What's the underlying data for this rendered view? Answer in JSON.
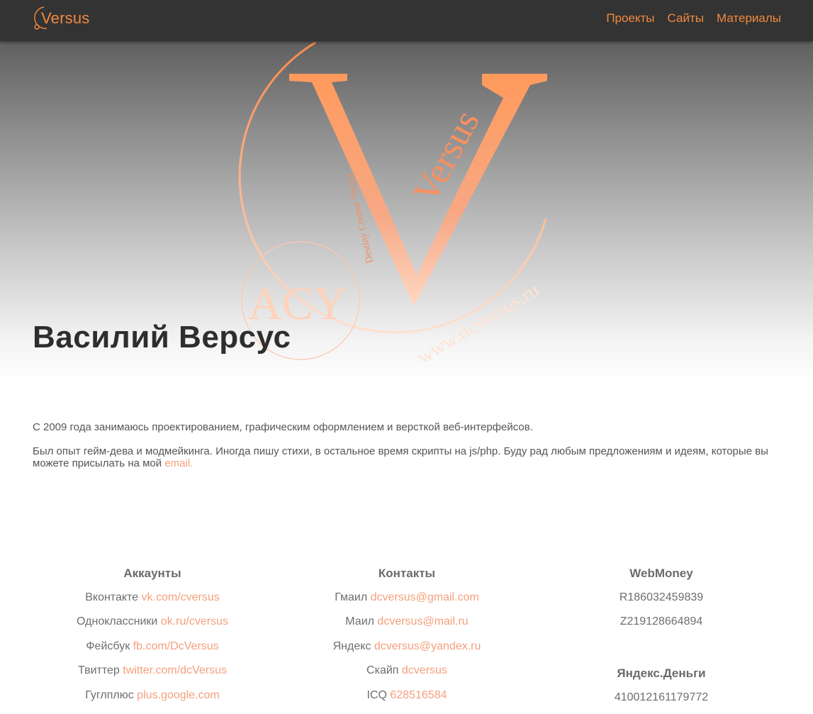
{
  "navbar": {
    "brand": "Versus",
    "links": [
      "Проекты",
      "Сайты",
      "Материалы"
    ]
  },
  "hero": {
    "name": "Василий Версус",
    "logo_texts": [
      "Versus",
      "Destiny Creator Versus",
      "ACY",
      "www.dcversus.ru"
    ]
  },
  "about": {
    "line1": "С 2009 года занимаюсь проектированием, графическим оформлением и версткой веб-интерфейсов.",
    "line2": "Был опыт гейм-дева и модмейкинга. Иногда пишу стихи, в остальное время скрипты на js/php. Буду рад любым предложениям и идеям, которые вы можете присылать на мой ",
    "email_link": "email."
  },
  "accounts": {
    "title": "Аккаунты",
    "items": [
      {
        "label": "Вконтакте",
        "link": "vk.com/cversus"
      },
      {
        "label": "Одноклассники",
        "link": "ok.ru/cversus"
      },
      {
        "label": "Фейсбук",
        "link": "fb.com/DcVersus"
      },
      {
        "label": "Твиттер",
        "link": "twitter.com/dcVersus"
      },
      {
        "label": "Гуглплюс",
        "link": "plus.google.com"
      }
    ]
  },
  "contacts": {
    "title": "Контакты",
    "items": [
      {
        "label": "Гмаил",
        "link": "dcversus@gmail.com"
      },
      {
        "label": "Маил",
        "link": "dcversus@mail.ru"
      },
      {
        "label": "Яндекс",
        "link": "dcversus@yandex.ru"
      },
      {
        "label": "Скайп",
        "link": "dcversus"
      },
      {
        "label": "ICQ",
        "link": "628516584"
      }
    ]
  },
  "webmoney": {
    "title": "WebMoney",
    "items": [
      "R186032459839",
      "Z219128664894"
    ]
  },
  "yandex_money": {
    "title": "Яндекс.Деньги",
    "items": [
      "410012161179772"
    ]
  },
  "colors": {
    "accent": "#f08a3e",
    "link": "#f4a07c",
    "navbar": "#333333"
  }
}
